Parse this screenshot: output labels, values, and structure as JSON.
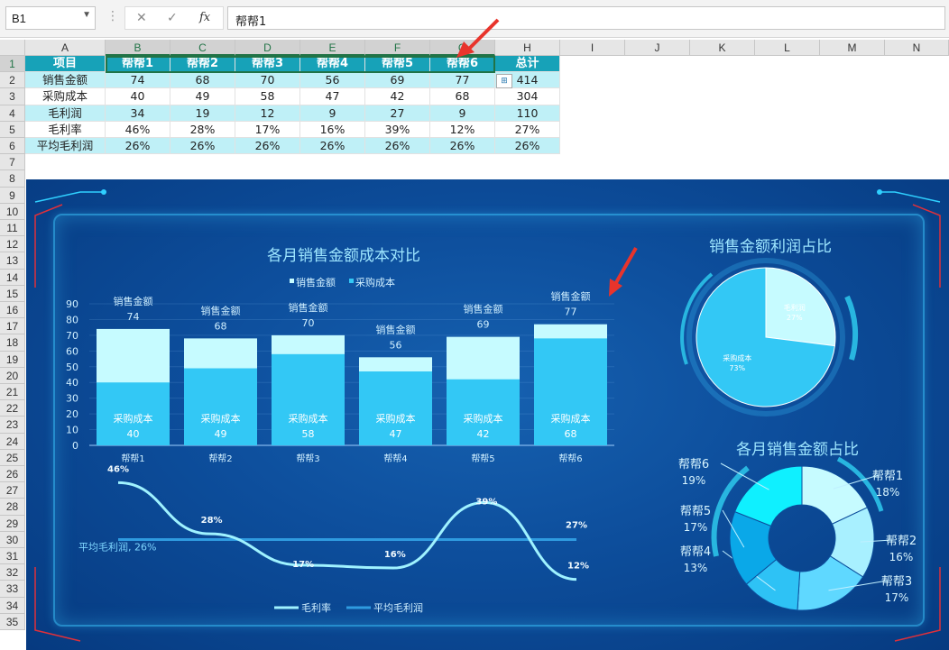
{
  "formula_bar": {
    "name_box": "B1",
    "formula": "帮帮1",
    "fx": "fx"
  },
  "columns": [
    "A",
    "B",
    "C",
    "D",
    "E",
    "F",
    "G",
    "H",
    "I",
    "J",
    "K",
    "L",
    "M",
    "N"
  ],
  "rows": [
    "1",
    "2",
    "3",
    "4",
    "5",
    "6",
    "7",
    "8",
    "9",
    "10",
    "11",
    "12",
    "13",
    "14",
    "15",
    "16",
    "17",
    "18",
    "19",
    "20",
    "21",
    "22",
    "23",
    "24",
    "25",
    "26",
    "27",
    "28",
    "29",
    "30",
    "31",
    "32",
    "33",
    "34",
    "35"
  ],
  "table": {
    "header": [
      "项目",
      "帮帮1",
      "帮帮2",
      "帮帮3",
      "帮帮4",
      "帮帮5",
      "帮帮6",
      "总计"
    ],
    "rows": [
      [
        "销售金额",
        "74",
        "68",
        "70",
        "56",
        "69",
        "77",
        "414"
      ],
      [
        "采购成本",
        "40",
        "49",
        "58",
        "47",
        "42",
        "68",
        "304"
      ],
      [
        "毛利润",
        "34",
        "19",
        "12",
        "9",
        "27",
        "9",
        "110"
      ],
      [
        "毛利率",
        "46%",
        "28%",
        "17%",
        "16%",
        "39%",
        "12%",
        "27%"
      ],
      [
        "平均毛利润",
        "26%",
        "26%",
        "26%",
        "26%",
        "26%",
        "26%",
        "26%"
      ]
    ]
  },
  "dashboard": {
    "colors": {
      "bg": "#0d4e9c",
      "cost": "#33c8f5",
      "sales": "#c6fbff",
      "line": "#9ff2ff",
      "avg": "#2f9be0"
    },
    "bar_title": "各月销售金额成本对比",
    "bar_legend": [
      "销售金额",
      "采购成本"
    ],
    "line_legend": [
      "毛利率",
      "平均毛利润"
    ],
    "avg_label": "平均毛利润, 26%",
    "pie1_title": "销售金额利润占比",
    "pie2_title": "各月销售金额占比"
  },
  "chart_data": [
    {
      "type": "bar",
      "title": "各月销售金额成本对比",
      "categories": [
        "帮帮1",
        "帮帮2",
        "帮帮3",
        "帮帮4",
        "帮帮5",
        "帮帮6"
      ],
      "series": [
        {
          "name": "销售金额",
          "values": [
            74,
            68,
            70,
            56,
            69,
            77
          ]
        },
        {
          "name": "采购成本",
          "values": [
            40,
            49,
            58,
            47,
            42,
            68
          ]
        }
      ],
      "yticks": [
        "0",
        "10",
        "20",
        "30",
        "40",
        "50",
        "60",
        "70",
        "80",
        "90"
      ],
      "ylim": [
        0,
        90
      ],
      "legend": "top"
    },
    {
      "type": "line",
      "categories": [
        "帮帮1",
        "帮帮2",
        "帮帮3",
        "帮帮4",
        "帮帮5",
        "帮帮6"
      ],
      "series": [
        {
          "name": "毛利率",
          "values": [
            46,
            28,
            17,
            16,
            39,
            12
          ],
          "labels": [
            "46%",
            "28%",
            "17%",
            "16%",
            "39%",
            "12%"
          ]
        },
        {
          "name": "平均毛利润",
          "values": [
            26,
            26,
            26,
            26,
            26,
            26
          ]
        }
      ],
      "end_label": "27%",
      "legend": "bottom"
    },
    {
      "type": "pie",
      "title": "销售金额利润占比",
      "slices": [
        {
          "name": "毛利润",
          "value": 27,
          "label": "27%"
        },
        {
          "name": "采购成本",
          "value": 73,
          "label": "73%"
        }
      ]
    },
    {
      "type": "pie",
      "title": "各月销售金额占比",
      "donut": true,
      "slices": [
        {
          "name": "帮帮1",
          "value": 18,
          "label": "18%"
        },
        {
          "name": "帮帮2",
          "value": 16,
          "label": "16%"
        },
        {
          "name": "帮帮3",
          "value": 17,
          "label": "17%"
        },
        {
          "name": "帮帮4",
          "value": 13,
          "label": "13%"
        },
        {
          "name": "帮帮5",
          "value": 17,
          "label": "17%"
        },
        {
          "name": "帮帮6",
          "value": 19,
          "label": "19%"
        }
      ]
    }
  ]
}
